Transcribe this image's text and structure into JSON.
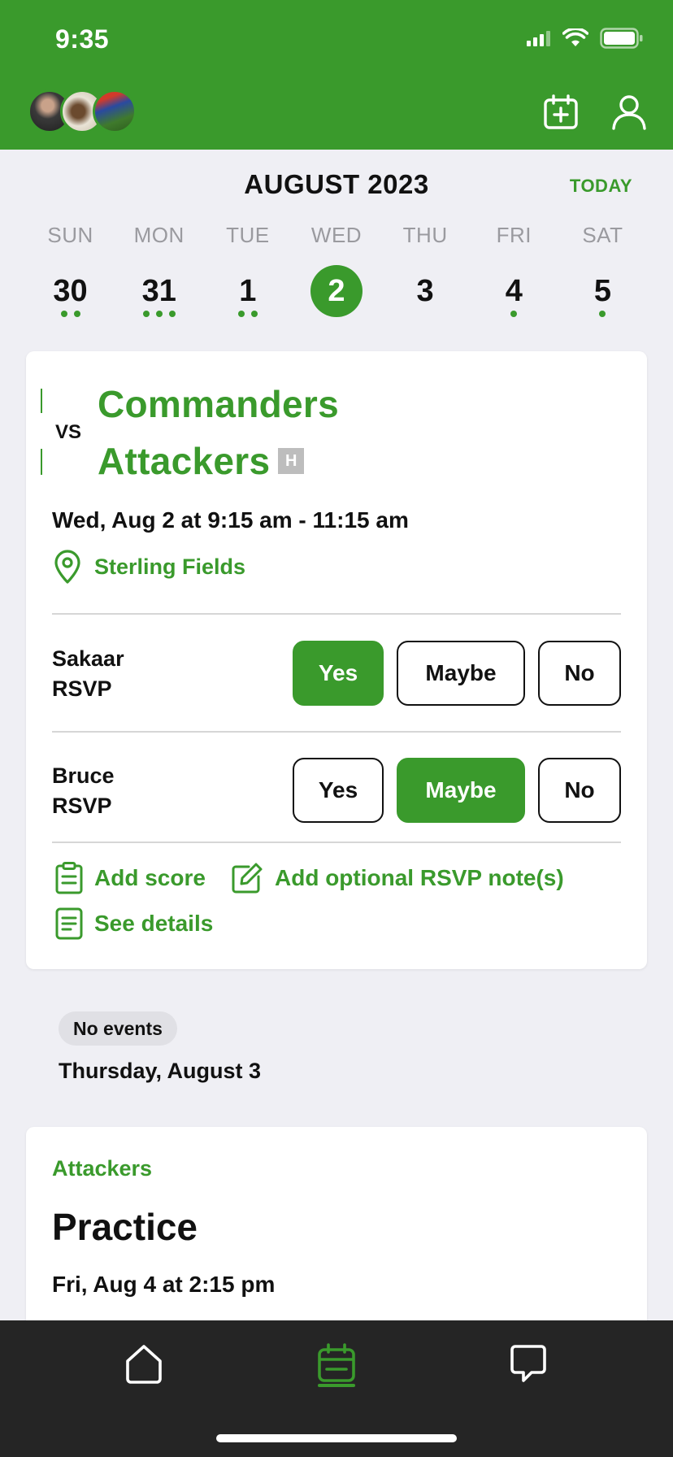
{
  "status": {
    "time": "9:35"
  },
  "calendar": {
    "month_title": "AUGUST 2023",
    "today_label": "TODAY",
    "weekdays": [
      "SUN",
      "MON",
      "TUE",
      "WED",
      "THU",
      "FRI",
      "SAT"
    ],
    "dates": [
      "30",
      "31",
      "1",
      "2",
      "3",
      "4",
      "5"
    ],
    "selected_index": 3,
    "event_dot_counts": [
      2,
      3,
      2,
      0,
      0,
      1,
      1
    ]
  },
  "game": {
    "vs_label": "VS",
    "opponent": "Commanders",
    "team": "Attackers",
    "home_badge": "H",
    "datetime": "Wed, Aug 2 at 9:15 am - 11:15 am",
    "location": "Sterling Fields",
    "rsvps": [
      {
        "name": "Sakaar",
        "label": "RSVP",
        "selected": "Yes"
      },
      {
        "name": "Bruce",
        "label": "RSVP",
        "selected": "Maybe"
      }
    ],
    "rsvp_options": [
      "Yes",
      "Maybe",
      "No"
    ],
    "actions": {
      "add_score": "Add score",
      "add_note": "Add optional RSVP note(s)",
      "see_details": "See details"
    }
  },
  "no_events": {
    "pill": "No events",
    "day": "Thursday, August 3"
  },
  "practice": {
    "team": "Attackers",
    "title": "Practice",
    "datetime": "Fri, Aug 4 at 2:15 pm"
  },
  "colors": {
    "brand": "#3a9a2c",
    "tabbar": "#252525"
  },
  "tabs": [
    "home-icon",
    "calendar-icon",
    "chat-icon"
  ],
  "active_tab": "calendar-icon"
}
